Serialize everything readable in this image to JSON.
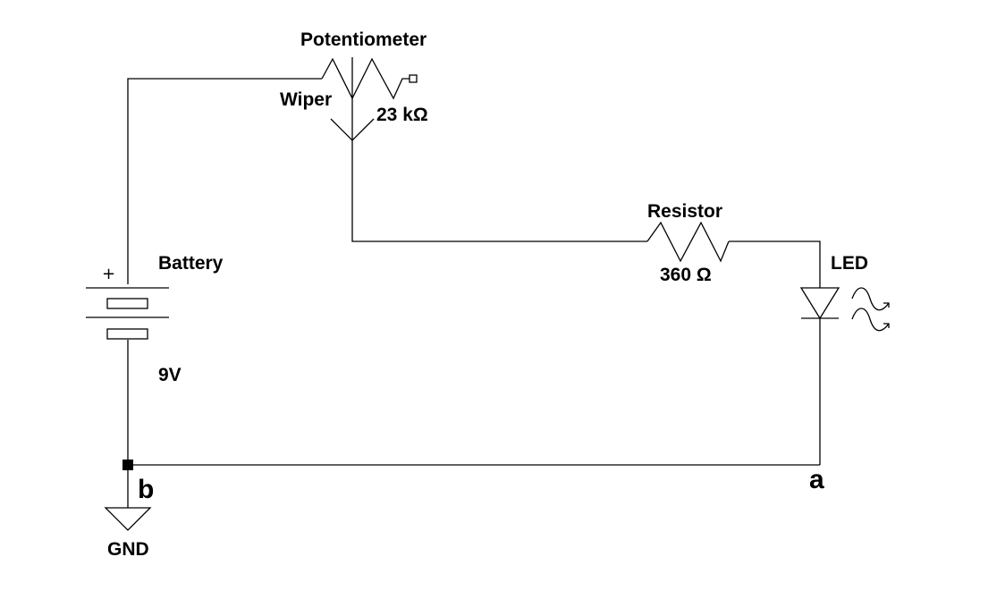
{
  "diagram": {
    "labels": {
      "potentiometer": "Potentiometer",
      "wiper": "Wiper",
      "pot_value": "23 kΩ",
      "resistor": "Resistor",
      "resistor_value": "360 Ω",
      "led": "LED",
      "battery": "Battery",
      "battery_voltage": "9V",
      "battery_plus": "+",
      "node_b": "b",
      "node_a": "a",
      "ground": "GND"
    },
    "colors": {
      "line": "#000000",
      "background": "#ffffff"
    }
  }
}
